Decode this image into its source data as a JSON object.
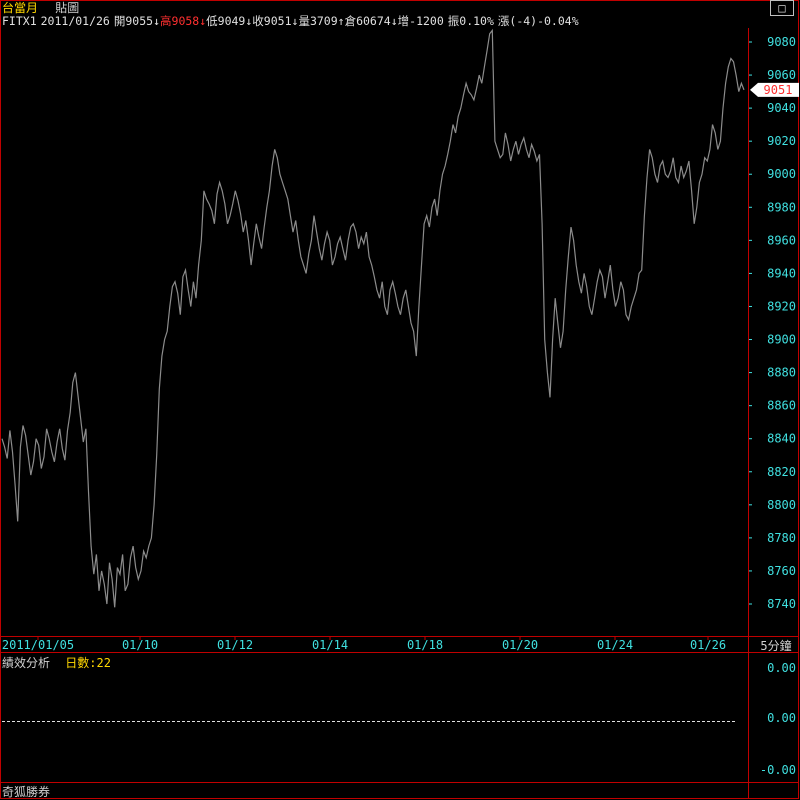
{
  "window": {
    "title": "台當月",
    "mode": "貼圖",
    "close_label": "□"
  },
  "quote": {
    "symbol": "FITX1",
    "date": "2011/01/26",
    "open_label": "開",
    "open_value": "9055",
    "high_label": "高",
    "high_value": "9058",
    "low_label": "低",
    "low_value": "9049",
    "close_label": "收",
    "close_value": "9051",
    "volume_label": "量",
    "volume_value": "3709",
    "oi_label": "倉",
    "oi_value": "60674",
    "oi_change_label": "增",
    "oi_change_value": "-1200",
    "amplitude_label": "振",
    "amplitude_value": "0.10%",
    "change_label": "漲",
    "change_value": "(-4)-0.04%",
    "arrow_down": "↓",
    "arrow_up": "↑"
  },
  "performance": {
    "label": "績效分析",
    "days_label": "日數:22",
    "footer": "奇狐勝券"
  },
  "colors": {
    "background": "#000000",
    "price_line": "#8c8c8c",
    "axis_text": "#40e0e0",
    "frame": "#c00000",
    "date_text": "#40e0e0",
    "highlight_red": "#ff3030",
    "title_yellow": "#ffd700"
  },
  "chart_data": [
    {
      "type": "line",
      "interval_label": "5分鐘",
      "x_tick_labels": [
        "2011/01/05",
        "01/10",
        "01/12",
        "01/14",
        "01/18",
        "01/20",
        "01/24",
        "01/26"
      ],
      "y_ticks": [
        8740,
        8760,
        8780,
        8800,
        8820,
        8840,
        8860,
        8880,
        8900,
        8920,
        8940,
        8960,
        8980,
        9000,
        9020,
        9040,
        9060,
        9080
      ],
      "ylim": [
        8725,
        9090
      ],
      "last_price_label": "9051",
      "series": [
        {
          "values": [
            8840,
            8835,
            8828,
            8845,
            8832,
            8812,
            8790,
            8835,
            8848,
            8842,
            8830,
            8818,
            8826,
            8840,
            8836,
            8822,
            8829,
            8846,
            8840,
            8832,
            8826,
            8838,
            8846,
            8834,
            8827,
            8845,
            8856,
            8874,
            8880,
            8866,
            8852,
            8838,
            8846,
            8808,
            8775,
            8758,
            8770,
            8748,
            8760,
            8752,
            8740,
            8765,
            8755,
            8738,
            8762,
            8758,
            8770,
            8748,
            8752,
            8768,
            8775,
            8762,
            8755,
            8760,
            8772,
            8768,
            8775,
            8780,
            8800,
            8830,
            8870,
            8890,
            8900,
            8905,
            8920,
            8932,
            8935,
            8928,
            8915,
            8938,
            8942,
            8930,
            8920,
            8935,
            8925,
            8945,
            8960,
            8990,
            8985,
            8982,
            8978,
            8970,
            8988,
            8995,
            8990,
            8982,
            8970,
            8975,
            8982,
            8990,
            8984,
            8976,
            8965,
            8972,
            8960,
            8945,
            8958,
            8970,
            8962,
            8955,
            8968,
            8980,
            8990,
            9005,
            9015,
            9010,
            9000,
            8995,
            8990,
            8985,
            8975,
            8965,
            8972,
            8960,
            8950,
            8945,
            8940,
            8952,
            8960,
            8975,
            8965,
            8955,
            8948,
            8958,
            8965,
            8960,
            8945,
            8950,
            8958,
            8962,
            8955,
            8948,
            8960,
            8968,
            8970,
            8965,
            8955,
            8962,
            8958,
            8965,
            8950,
            8945,
            8938,
            8930,
            8925,
            8935,
            8920,
            8915,
            8930,
            8935,
            8928,
            8920,
            8915,
            8925,
            8930,
            8920,
            8910,
            8905,
            8890,
            8920,
            8945,
            8970,
            8975,
            8968,
            8980,
            8985,
            8975,
            8990,
            9000,
            9005,
            9012,
            9020,
            9030,
            9025,
            9035,
            9040,
            9048,
            9055,
            9050,
            9048,
            9045,
            9052,
            9060,
            9055,
            9065,
            9075,
            9085,
            9087,
            9020,
            9015,
            9010,
            9012,
            9025,
            9018,
            9008,
            9015,
            9020,
            9012,
            9018,
            9022,
            9015,
            9010,
            9018,
            9014,
            9008,
            9012,
            8970,
            8900,
            8880,
            8865,
            8900,
            8925,
            8910,
            8895,
            8905,
            8930,
            8950,
            8968,
            8960,
            8945,
            8935,
            8928,
            8940,
            8932,
            8920,
            8915,
            8925,
            8935,
            8942,
            8938,
            8925,
            8935,
            8945,
            8930,
            8920,
            8925,
            8935,
            8930,
            8915,
            8912,
            8920,
            8925,
            8930,
            8940,
            8942,
            8975,
            8998,
            9015,
            9010,
            9000,
            8995,
            9005,
            9008,
            9000,
            8998,
            9002,
            9010,
            8998,
            8995,
            9005,
            8998,
            9002,
            9008,
            8990,
            8970,
            8980,
            8995,
            9000,
            9010,
            9008,
            9015,
            9030,
            9025,
            9015,
            9020,
            9040,
            9055,
            9065,
            9070,
            9068,
            9060,
            9050,
            9055,
            9051
          ]
        }
      ]
    },
    {
      "type": "line",
      "title": "績效分析",
      "y_ticks": [
        "0.00",
        "0.00",
        "-0.00"
      ]
    }
  ]
}
